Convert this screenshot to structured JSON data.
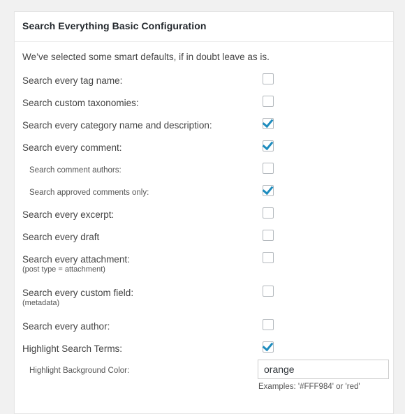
{
  "panel": {
    "title": "Search Everything Basic Configuration",
    "intro": "We’ve selected some smart defaults, if in doubt leave as is."
  },
  "options": [
    {
      "label": "Search every tag name:",
      "sub": "",
      "indent": false,
      "checked": false
    },
    {
      "label": "Search custom taxonomies:",
      "sub": "",
      "indent": false,
      "checked": false
    },
    {
      "label": "Search every category name and description:",
      "sub": "",
      "indent": false,
      "checked": true
    },
    {
      "label": "Search every comment:",
      "sub": "",
      "indent": false,
      "checked": true
    },
    {
      "label": "Search comment authors:",
      "sub": "",
      "indent": true,
      "checked": false
    },
    {
      "label": "Search approved comments only:",
      "sub": "",
      "indent": true,
      "checked": true
    },
    {
      "label": "Search every excerpt:",
      "sub": "",
      "indent": false,
      "checked": false
    },
    {
      "label": "Search every draft",
      "sub": "",
      "indent": false,
      "checked": false
    },
    {
      "label": "Search every attachment:",
      "sub": "(post type = attachment)",
      "indent": false,
      "checked": false
    },
    {
      "label": "Search every custom field:",
      "sub": "(metadata)",
      "indent": false,
      "checked": false
    },
    {
      "label": "Search every author:",
      "sub": "",
      "indent": false,
      "checked": false
    },
    {
      "label": "Highlight Search Terms:",
      "sub": "",
      "indent": false,
      "checked": true
    }
  ],
  "highlight_color": {
    "label": "Highlight Background Color:",
    "value": "orange",
    "placeholder": "",
    "hint": "Examples: '#FFF984' or 'red'"
  },
  "colors": {
    "page_background": "#f1f1f1",
    "panel_background": "#ffffff",
    "panel_border": "#e5e5e5",
    "title_text": "#23282d",
    "body_text": "#444444",
    "checkbox_border": "#b4b9be",
    "checkbox_check": "#1e8cbe",
    "input_border": "#cccccc"
  }
}
